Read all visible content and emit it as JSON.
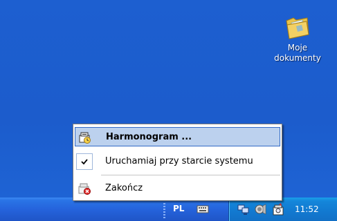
{
  "desktop": {
    "icon": {
      "name": "folder-docs-icon",
      "line1": "Moje",
      "line2": "dokumenty"
    }
  },
  "menu": {
    "items": [
      {
        "label": "Harmonogram ...",
        "icon": "scheduler-icon",
        "highlighted": true
      },
      {
        "label": "Uruchamiaj przy starcie systemu",
        "icon": "checkmark-icon",
        "checked": true
      },
      {
        "label": "Zakończ",
        "icon": "exit-icon"
      }
    ]
  },
  "taskbar": {
    "language": "PL",
    "clock": "11:52",
    "tray_icons": [
      "keyboard-icon",
      "network-icon",
      "volume-icon",
      "scheduler-tray-icon"
    ]
  },
  "colors": {
    "desktop_bg": "#1e5fcf",
    "menu_highlight": "#bcd1ee",
    "menu_highlight_border": "#3169c6",
    "tray_bg": "#1279d0"
  }
}
